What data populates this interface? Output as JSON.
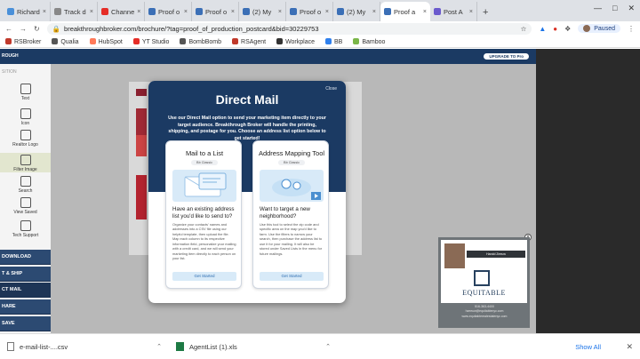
{
  "browser": {
    "tabs": [
      {
        "label": "Richard",
        "color": "#4a90d9"
      },
      {
        "label": "Track d",
        "color": "#888888"
      },
      {
        "label": "Channe",
        "color": "#e52d27"
      },
      {
        "label": "Proof o",
        "color": "#3b6fb6"
      },
      {
        "label": "Proof o",
        "color": "#3b6fb6"
      },
      {
        "label": "(2) My",
        "color": "#3b6fb6"
      },
      {
        "label": "Proof o",
        "color": "#3b6fb6"
      },
      {
        "label": "(2) My",
        "color": "#3b6fb6"
      },
      {
        "label": "Proof a",
        "color": "#3b6fb6"
      },
      {
        "label": "Post A",
        "color": "#6a5acd"
      }
    ],
    "active_tab_index": 8,
    "url": "breakthroughbroker.com/brochure/?tag=proof_of_production_postcard&bid=30229753",
    "profile_status": "Paused",
    "bookmarks": [
      {
        "label": "RSBroker",
        "color": "#c0392b"
      },
      {
        "label": "Qualia",
        "color": "#555555"
      },
      {
        "label": "HubSpot",
        "color": "#ff7a59"
      },
      {
        "label": "YT Studio",
        "color": "#e52d27"
      },
      {
        "label": "BombBomb",
        "color": "#555555"
      },
      {
        "label": "RSAgent",
        "color": "#c0392b"
      },
      {
        "label": "Workplace",
        "color": "#333333"
      },
      {
        "label": "BB",
        "color": "#2f80ed"
      },
      {
        "label": "Bamboo",
        "color": "#7ab648"
      }
    ]
  },
  "app": {
    "header_brand": "ROUGH",
    "upgrade_label": "UPGRADE TO Pro",
    "sidebar_top_label": "SITION",
    "sidebar_tools": [
      {
        "label": "Text",
        "icon": "text-icon"
      },
      {
        "label": "Icon",
        "icon": "shape-icon"
      },
      {
        "label": "Realtor Logo",
        "icon": "logo-icon"
      },
      {
        "label": "Filter Image",
        "icon": "image-icon"
      },
      {
        "label": "Search",
        "icon": "search-icon"
      },
      {
        "label": "View Saved",
        "icon": "folder-icon"
      },
      {
        "label": "Tech Support",
        "icon": "support-icon"
      }
    ],
    "sidebar_nav": [
      "DOWNLOAD",
      "T & SHIP",
      "CT MAIL",
      "HARE",
      "SAVE"
    ],
    "sidebar_nav_selected": 2
  },
  "modal": {
    "close_label": "Close",
    "title": "Direct Mail",
    "description": "Use our Direct Mail option to send your marketing item directly to your target audience. Breakthrough Broker will handle the printing, shipping, and postage for you. Choose an address list option below to get started!",
    "options": [
      {
        "title": "Mail to a List",
        "badge": "Bb Classic",
        "question": "Have an existing address list you'd like to send to?",
        "body": "Organize your contacts' names and addresses into a CSV file using our helpful template, then upload the file. Map each column to its respective information field, personalize your mailing with a credit card, and we will send your marketing item directly to each person on your list.",
        "button": "Get Started"
      },
      {
        "title": "Address Mapping Tool",
        "badge": "Bb Classic",
        "question": "Want to target a new neighborhood?",
        "body": "Use this tool to select the zip code and specific area on the map you'd like to farm. Use the filters to narrow your search, then purchase the address list to use it for your mailing. It will also be stored under Saved Lists in the menu for future mailings.",
        "button": "Get Started"
      }
    ]
  },
  "preview": {
    "name_bar": "Harold Zeeuw",
    "logo_text": "EQUITABLE",
    "contact_lines": [
      "516-363-4400",
      "hzeeuw@equitablenyc.com",
      "www.equitablerealestatenyc.com"
    ]
  },
  "downloads": {
    "items": [
      {
        "name": "e-mail-list-....csv",
        "icon": "file-icon"
      },
      {
        "name": "AgentList (1).xls",
        "icon": "excel-icon"
      }
    ],
    "show_all": "Show All"
  }
}
